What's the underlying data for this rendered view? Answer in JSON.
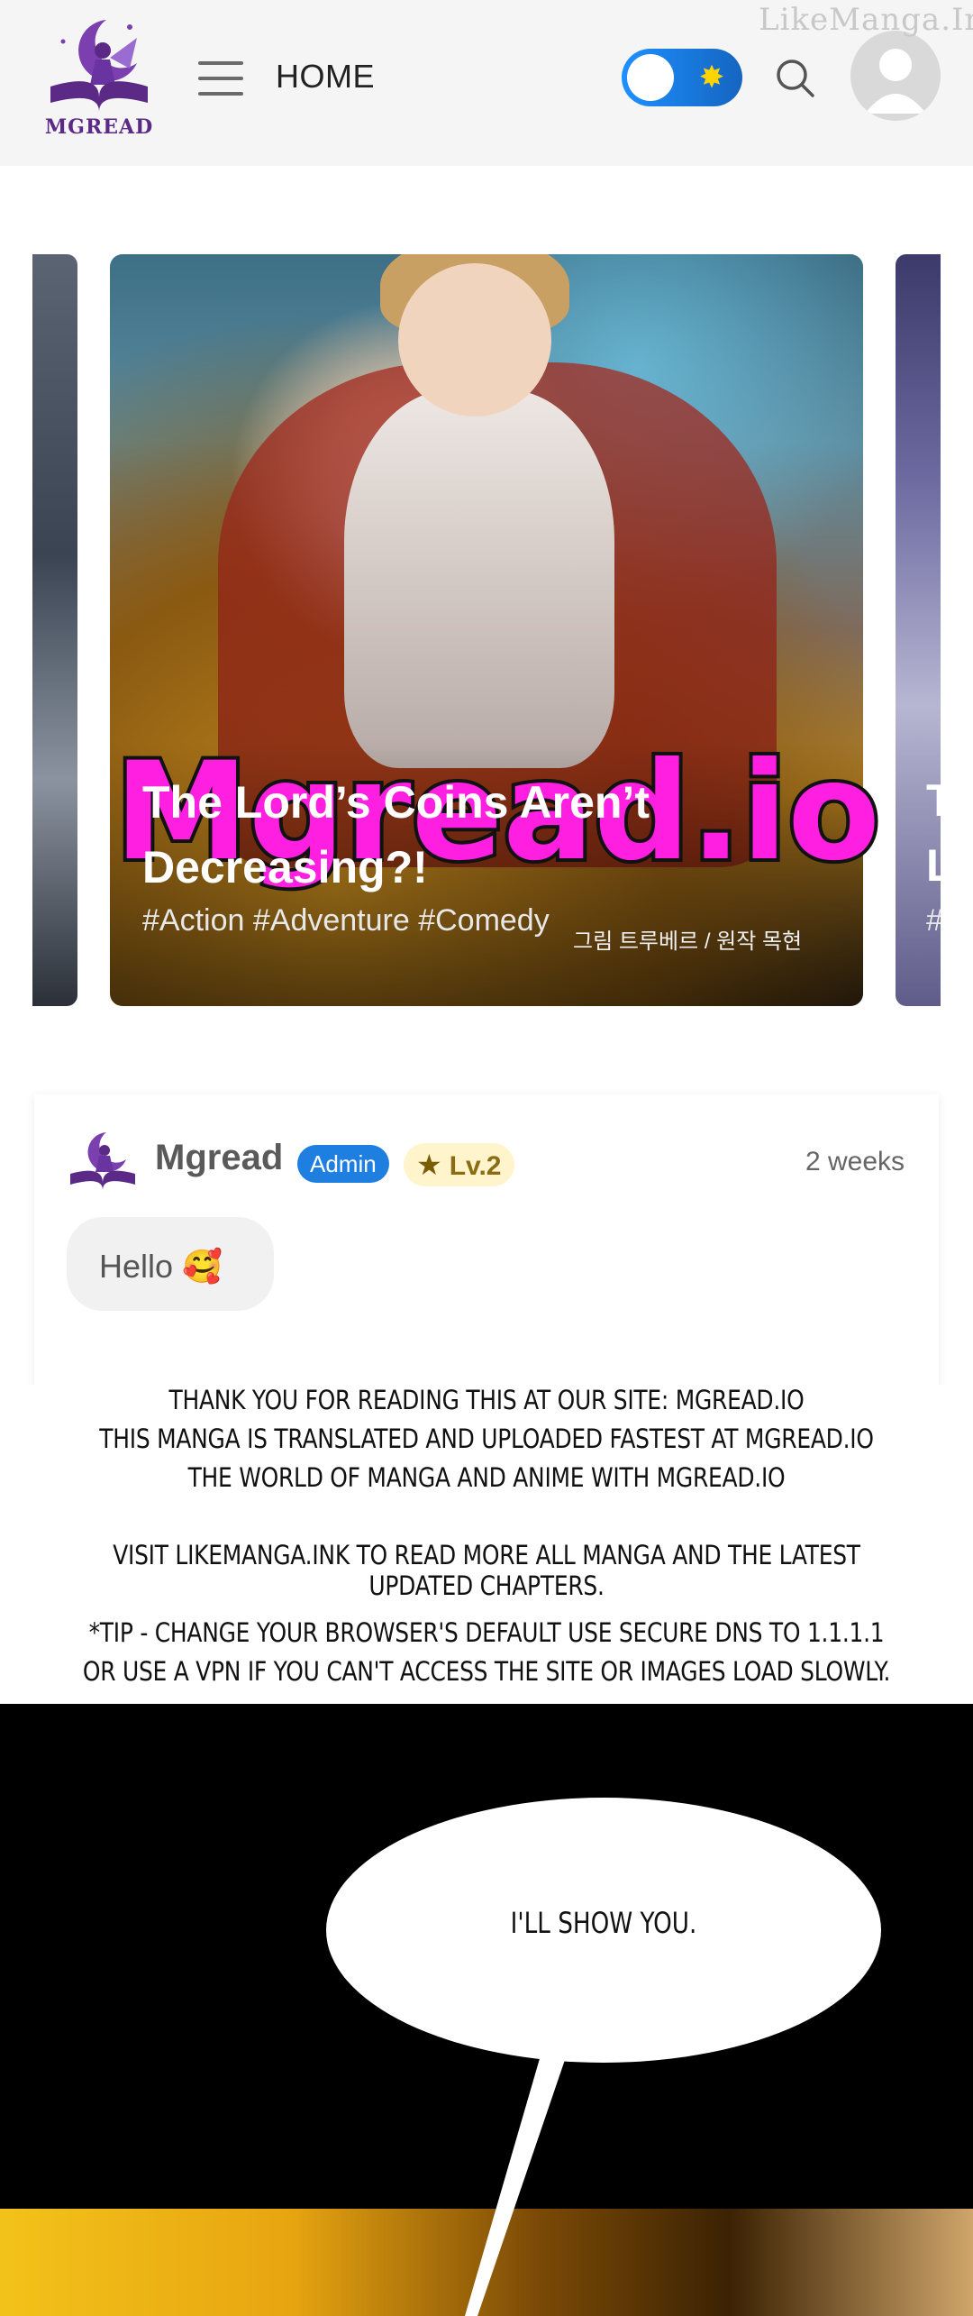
{
  "header": {
    "logo_text": "MGREAD",
    "nav_label": "HOME",
    "watermark": "LikeManga.Ink",
    "icons": {
      "menu": "hamburger-icon",
      "theme": "sun-icon",
      "search": "search-icon",
      "profile": "user-icon"
    }
  },
  "carousel": {
    "banner_text": "Mgread.io",
    "main": {
      "title": "The Lord’s Coins Aren’t Decreasing?!",
      "tags": "#Action #Adventure #Comedy",
      "credit": "그림 트루베르 / 원작 목현"
    },
    "right_peek": {
      "title_fragment": "T L",
      "tag_fragment": "#"
    }
  },
  "comment": {
    "author": "Mgread",
    "role_badge": "Admin",
    "level_badge": "Lv.2",
    "time": "2 weeks",
    "message": "Hello 🥰"
  },
  "notice": {
    "lines": [
      "THANK YOU FOR READING THIS AT OUR SITE: MGREAD.IO",
      "THIS MANGA IS TRANSLATED AND UPLOADED FASTEST AT MGREAD.IO",
      "THE WORLD OF MANGA AND ANIME WITH MGREAD.IO",
      "VISIT LIKEMANGA.INK TO READ MORE ALL MANGA AND THE LATEST UPDATED CHAPTERS.",
      "*TIP - CHANGE YOUR BROWSER'S DEFAULT USE SECURE DNS TO 1.1.1.1",
      "OR USE A VPN IF YOU CAN'T ACCESS THE SITE OR IMAGES LOAD SLOWLY."
    ]
  },
  "panel": {
    "speech": "I'LL SHOW YOU."
  },
  "colors": {
    "accent_blue": "#1e7fe0",
    "brand_purple": "#5b2a86",
    "banner_magenta": "#ff1fe0"
  }
}
